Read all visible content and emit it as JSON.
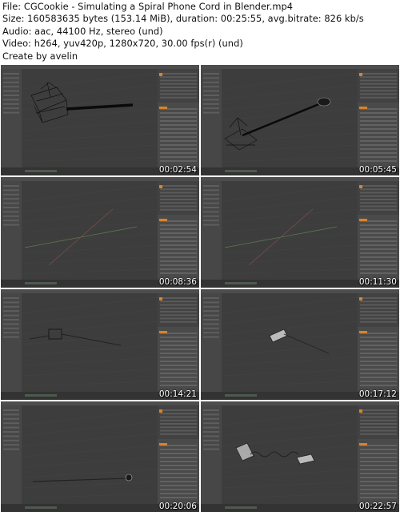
{
  "info": {
    "file": "File: CGCookie - Simulating a Spiral Phone Cord in Blender.mp4",
    "size": "Size: 160583635 bytes (153.14 MiB), duration: 00:25:55, avg.bitrate: 826 kb/s",
    "audio": "Audio: aac, 44100 Hz, stereo (und)",
    "video": "Video: h264, yuv420p, 1280x720, 30.00 fps(r) (und)",
    "credit": "Create by avelin"
  },
  "thumbnails": [
    {
      "timestamp": "00:02:54",
      "scene": "cage-cord-left"
    },
    {
      "timestamp": "00:05:45",
      "scene": "cage-cord-diag"
    },
    {
      "timestamp": "00:08:36",
      "scene": "empty-grid"
    },
    {
      "timestamp": "00:11:30",
      "scene": "empty-grid-2"
    },
    {
      "timestamp": "00:14:21",
      "scene": "small-box-line"
    },
    {
      "timestamp": "00:17:12",
      "scene": "phone-handset"
    },
    {
      "timestamp": "00:20:06",
      "scene": "cord-right"
    },
    {
      "timestamp": "00:22:57",
      "scene": "phone-coiled-cord"
    }
  ]
}
